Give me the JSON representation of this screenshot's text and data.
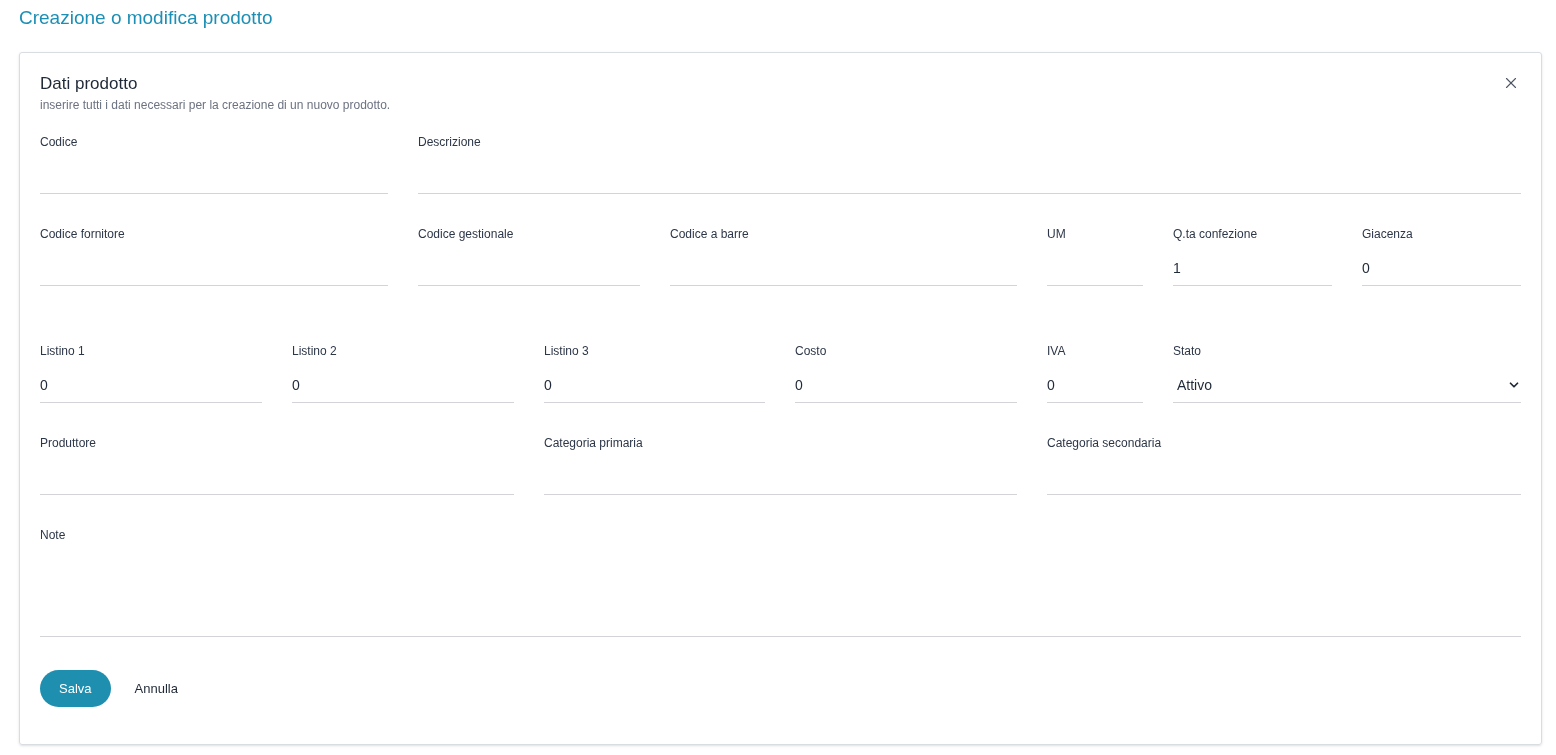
{
  "page_title": "Creazione o modifica prodotto",
  "card": {
    "title": "Dati prodotto",
    "subtitle": "inserire tutti i dati necessari per la creazione di un nuovo prodotto."
  },
  "rows": [
    {
      "fields": [
        {
          "kind": "text",
          "label": "Codice"
        },
        {
          "kind": "text",
          "label": "Descrizione"
        }
      ]
    },
    {
      "fields": [
        {
          "kind": "text",
          "label": "Codice fornitore"
        },
        {
          "kind": "text",
          "label": "Codice gestionale"
        },
        {
          "kind": "text",
          "label": "Codice a barre"
        },
        {
          "kind": "text",
          "label": "UM"
        },
        {
          "kind": "text",
          "label": "Q.ta confezione",
          "value": "1"
        },
        {
          "kind": "text",
          "label": "Giacenza",
          "value": "0"
        }
      ]
    },
    {
      "fields": [
        {
          "kind": "text",
          "label": "Listino 1",
          "value": "0"
        },
        {
          "kind": "text",
          "label": "Listino 2",
          "value": "0"
        },
        {
          "kind": "text",
          "label": "Listino 3",
          "value": "0"
        },
        {
          "kind": "text",
          "label": "Costo",
          "value": "0"
        },
        {
          "kind": "text",
          "label": "IVA",
          "value": "0"
        },
        {
          "kind": "select",
          "label": "Stato",
          "value": "Attivo"
        }
      ]
    },
    {
      "fields": [
        {
          "kind": "text",
          "label": "Produttore"
        },
        {
          "kind": "text",
          "label": "Categoria primaria"
        },
        {
          "kind": "text",
          "label": "Categoria secondaria"
        }
      ]
    },
    {
      "fields": [
        {
          "kind": "textarea",
          "label": "Note"
        }
      ]
    }
  ],
  "buttons": [
    {
      "kind": "primary",
      "label": "Salva"
    },
    {
      "kind": "link",
      "label": "Annulla"
    }
  ]
}
